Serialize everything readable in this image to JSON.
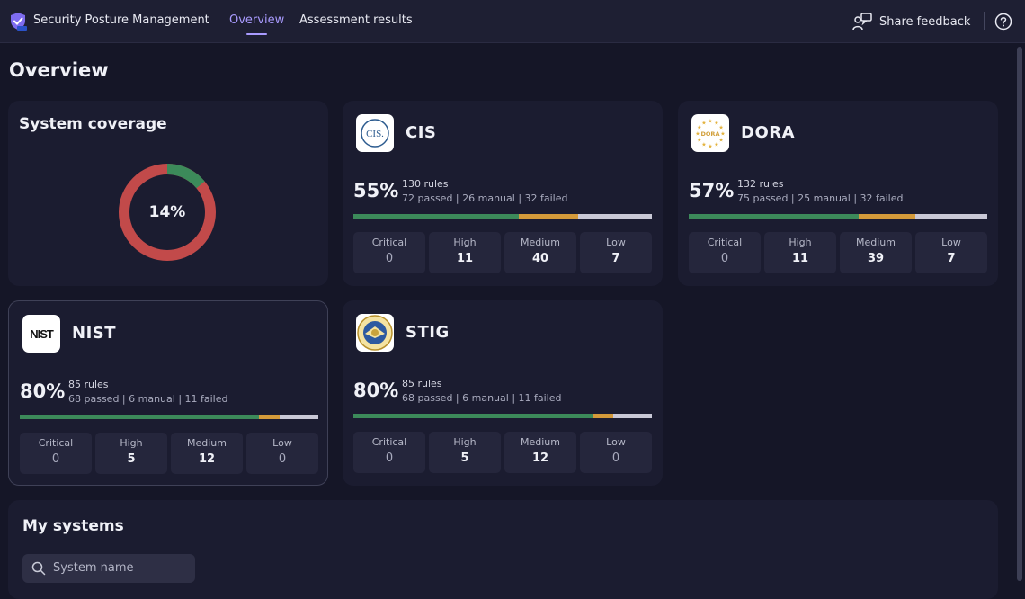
{
  "header": {
    "app_title": "Security Posture Management",
    "nav": [
      "Overview",
      "Assessment results"
    ],
    "active_tab": "Overview",
    "share_feedback": "Share feedback",
    "logo_icon": "shield-check-icon",
    "feedback_icon": "feedback-person-icon",
    "help_icon": "help-circle-icon"
  },
  "page": {
    "title": "Overview"
  },
  "coverage": {
    "title": "System coverage",
    "percent_label": "14%",
    "percent": 14,
    "colors": {
      "covered": "#3c8a5a",
      "uncovered": "#c24a4a"
    }
  },
  "standards": [
    {
      "id": "cis",
      "name": "CIS",
      "logo_text": "CIS.",
      "logo_icon": "cis-logo-icon",
      "percent": "55%",
      "rules": "130 rules",
      "breakdown": "72 passed | 26 manual | 32 failed",
      "counts": {
        "passed": 72,
        "manual": 26,
        "failed": 32
      },
      "severity": [
        {
          "label": "Critical",
          "value": "0"
        },
        {
          "label": "High",
          "value": "11"
        },
        {
          "label": "Medium",
          "value": "40"
        },
        {
          "label": "Low",
          "value": "7"
        }
      ]
    },
    {
      "id": "dora",
      "name": "DORA",
      "logo_text": "DORA",
      "logo_icon": "dora-eu-stars-icon",
      "percent": "57%",
      "rules": "132 rules",
      "breakdown": "75 passed | 25 manual | 32 failed",
      "counts": {
        "passed": 75,
        "manual": 25,
        "failed": 32
      },
      "severity": [
        {
          "label": "Critical",
          "value": "0"
        },
        {
          "label": "High",
          "value": "11"
        },
        {
          "label": "Medium",
          "value": "39"
        },
        {
          "label": "Low",
          "value": "7"
        }
      ]
    },
    {
      "id": "nist",
      "name": "NIST",
      "logo_text": "NIST",
      "logo_icon": "nist-logo-icon",
      "percent": "80%",
      "rules": "85 rules",
      "breakdown": "68 passed | 6 manual | 11 failed",
      "counts": {
        "passed": 68,
        "manual": 6,
        "failed": 11
      },
      "severity": [
        {
          "label": "Critical",
          "value": "0"
        },
        {
          "label": "High",
          "value": "5"
        },
        {
          "label": "Medium",
          "value": "12"
        },
        {
          "label": "Low",
          "value": "0"
        }
      ]
    },
    {
      "id": "stig",
      "name": "STIG",
      "logo_icon": "disa-seal-icon",
      "percent": "80%",
      "rules": "85 rules",
      "breakdown": "68 passed | 6 manual | 11 failed",
      "counts": {
        "passed": 68,
        "manual": 6,
        "failed": 11
      },
      "severity": [
        {
          "label": "Critical",
          "value": "0"
        },
        {
          "label": "High",
          "value": "5"
        },
        {
          "label": "Medium",
          "value": "12"
        },
        {
          "label": "Low",
          "value": "0"
        }
      ]
    }
  ],
  "systems": {
    "title": "My systems",
    "search_placeholder": "System name",
    "search_icon": "search-icon"
  }
}
